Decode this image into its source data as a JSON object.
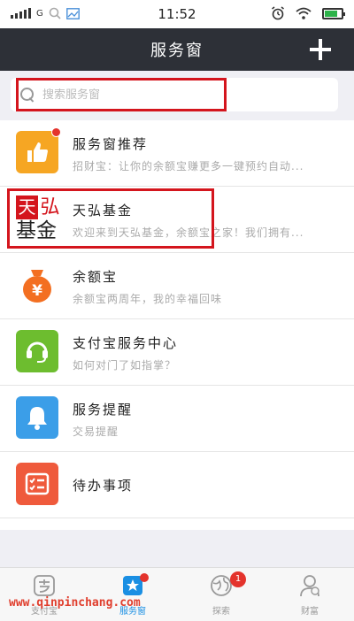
{
  "status_bar": {
    "network": "G",
    "time": "11:52"
  },
  "nav": {
    "title": "服务窗"
  },
  "search": {
    "placeholder": "搜索服务窗"
  },
  "items": [
    {
      "title": "服务窗推荐",
      "subtitle": "招财宝：让你的余额宝赚更多一键预约自动...",
      "icon": "thumbs-up-icon",
      "color": "#f6a623",
      "has_dot": true
    },
    {
      "title": "天弘基金",
      "subtitle": "欢迎来到天弘基金，余额宝之家！我们拥有...",
      "icon": "tianhong-logo",
      "logo_text_1": "天",
      "logo_text_2": "弘",
      "logo_text_3": "基金"
    },
    {
      "title": "余额宝",
      "subtitle": "余额宝两周年，我的幸福回味",
      "icon": "yuan-bag-icon",
      "color": "#f36f21"
    },
    {
      "title": "支付宝服务中心",
      "subtitle": "如何对门了如指掌？",
      "icon": "headset-icon",
      "color": "#6dbd2f"
    },
    {
      "title": "服务提醒",
      "subtitle": "交易提醒",
      "icon": "bell-icon",
      "color": "#3b9ee8"
    },
    {
      "title": "待办事项",
      "icon": "todo-list-icon",
      "color": "#ef5a3c"
    }
  ],
  "tabs": [
    {
      "label": "支付宝",
      "icon": "alipay-icon"
    },
    {
      "label": "服务窗",
      "icon": "service-window-icon",
      "active": true,
      "has_dot": true
    },
    {
      "label": "探索",
      "icon": "explore-icon",
      "badge": "1"
    },
    {
      "label": "财富",
      "icon": "wealth-icon"
    }
  ],
  "watermark": "www.qinpinchang.com",
  "colors": {
    "nav_bg": "#2d3037",
    "highlight": "#d4151d",
    "active_tab": "#1a8fe3"
  }
}
